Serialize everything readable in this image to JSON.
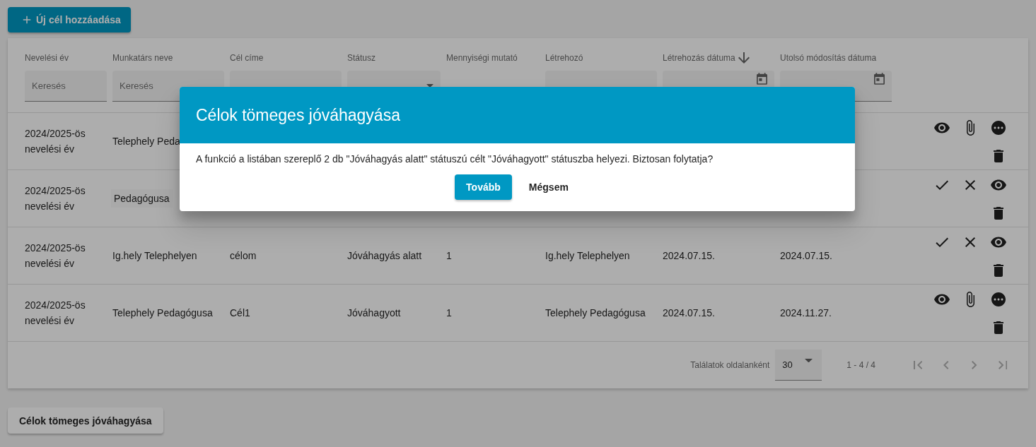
{
  "add_button": {
    "label": "Új cél hozzáadása"
  },
  "table": {
    "columns": [
      {
        "label": "Nevelési év",
        "filter": {
          "kind": "text",
          "placeholder": "Keresés"
        },
        "sorted_descending": false
      },
      {
        "label": "Munkatárs neve",
        "filter": {
          "kind": "text",
          "placeholder": "Keresés"
        },
        "sorted_descending": false
      },
      {
        "label": "Cél címe",
        "filter": {
          "kind": "text"
        },
        "sorted_descending": false
      },
      {
        "label": "Státusz",
        "filter": {
          "kind": "select"
        },
        "sorted_descending": false
      },
      {
        "label": "Mennyiségi mutató",
        "sorted_descending": false
      },
      {
        "label": "Létrehozó",
        "filter": {
          "kind": "text"
        },
        "sorted_descending": false
      },
      {
        "label": "Létrehozás dátuma",
        "filter": {
          "kind": "date"
        },
        "sorted_descending": true
      },
      {
        "label": "Utolsó módosítás dátuma",
        "filter": {
          "kind": "date"
        },
        "sorted_descending": false
      }
    ],
    "rows": [
      {
        "cells": [
          "2024/2025-ös nevelési év",
          "Telephely Peda"
        ],
        "name_highlighted": false,
        "actions": [
          {
            "kind": "view"
          },
          {
            "kind": "attach"
          },
          {
            "kind": "more"
          },
          {
            "kind": "delete"
          }
        ]
      },
      {
        "cells": [
          "2024/2025-ös nevelési év",
          "Pedagógusa"
        ],
        "name_highlighted": true,
        "actions": [
          {
            "kind": "approve"
          },
          {
            "kind": "reject"
          },
          {
            "kind": "view"
          },
          {
            "kind": "delete"
          }
        ]
      },
      {
        "cells": [
          "2024/2025-ös nevelési év",
          "Ig.hely Telephelyen",
          "célom",
          "Jóváhagyás alatt",
          "1",
          "Ig.hely Telephelyen",
          "2024.07.15.",
          "2024.07.15."
        ],
        "name_highlighted": false,
        "actions": [
          {
            "kind": "approve"
          },
          {
            "kind": "reject"
          },
          {
            "kind": "view"
          },
          {
            "kind": "delete"
          }
        ]
      },
      {
        "cells": [
          "2024/2025-ös nevelési év",
          "Telephely Pedagógusa",
          "Cél1",
          "Jóváhagyott",
          "1",
          "Telephely Pedagógusa",
          "2024.07.15.",
          "2024.11.27."
        ],
        "name_highlighted": false,
        "actions": [
          {
            "kind": "view"
          },
          {
            "kind": "attach"
          },
          {
            "kind": "more"
          },
          {
            "kind": "delete"
          }
        ]
      }
    ],
    "paginator": {
      "label": "Találatok oldalanként",
      "page_size": "30",
      "range": "1 - 4 / 4",
      "nav": [
        {
          "kind": "first",
          "disabled": true
        },
        {
          "kind": "prev",
          "disabled": true
        },
        {
          "kind": "next",
          "disabled": true
        },
        {
          "kind": "last",
          "disabled": true
        }
      ]
    }
  },
  "bulk_button": {
    "label": "Célok tömeges jóváhagyása"
  },
  "dialog": {
    "title": "Célok tömeges jóváhagyása",
    "message": "A funkció a listában szereplő 2 db \"Jóváhagyás alatt\" státuszú célt \"Jóváhagyott\" státuszba helyezi. Biztosan folytatja?",
    "buttons": [
      {
        "label": "Tovább",
        "kind": "primary"
      },
      {
        "label": "Mégsem",
        "kind": "text"
      }
    ]
  }
}
